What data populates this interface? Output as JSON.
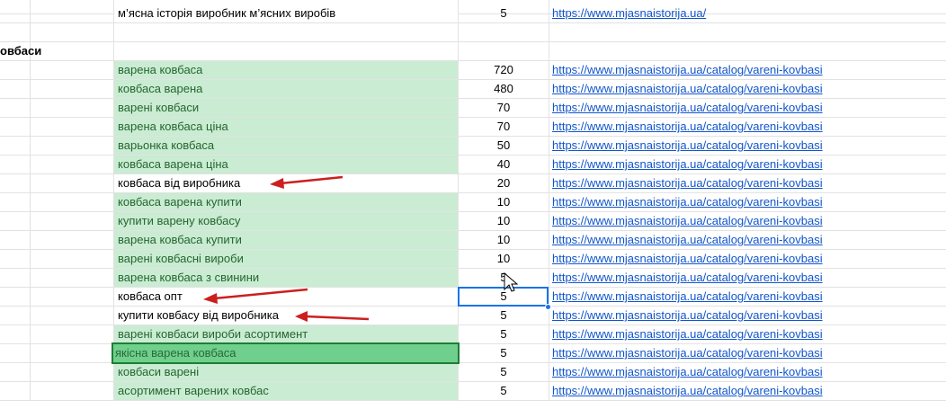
{
  "sheet": {
    "top_row": {
      "keyword": "м’ясна історія виробник м’ясних виробів",
      "volume": "5",
      "url": "https://www.mjasnaistorija.ua/"
    },
    "section_label": "овбаси",
    "rows": [
      {
        "keyword": "варена ковбаса",
        "volume": "720",
        "url": "https://www.mjasnaistorija.ua/catalog/vareni-kovbasi",
        "style": "green"
      },
      {
        "keyword": "ковбаса варена",
        "volume": "480",
        "url": "https://www.mjasnaistorija.ua/catalog/vareni-kovbasi",
        "style": "green"
      },
      {
        "keyword": "варені ковбаси",
        "volume": "70",
        "url": "https://www.mjasnaistorija.ua/catalog/vareni-kovbasi",
        "style": "green"
      },
      {
        "keyword": "варена ковбаса ціна",
        "volume": "70",
        "url": "https://www.mjasnaistorija.ua/catalog/vareni-kovbasi",
        "style": "green"
      },
      {
        "keyword": "варьонка ковбаса",
        "volume": "50",
        "url": "https://www.mjasnaistorija.ua/catalog/vareni-kovbasi",
        "style": "green"
      },
      {
        "keyword": "ковбаса варена ціна",
        "volume": "40",
        "url": "https://www.mjasnaistorija.ua/catalog/vareni-kovbasi",
        "style": "green"
      },
      {
        "keyword": "ковбаса від виробника",
        "volume": "20",
        "url": "https://www.mjasnaistorija.ua/catalog/vareni-kovbasi",
        "style": "white"
      },
      {
        "keyword": "ковбаса варена купити",
        "volume": "10",
        "url": "https://www.mjasnaistorija.ua/catalog/vareni-kovbasi",
        "style": "green"
      },
      {
        "keyword": "купити варену ковбасу",
        "volume": "10",
        "url": "https://www.mjasnaistorija.ua/catalog/vareni-kovbasi",
        "style": "green"
      },
      {
        "keyword": "варена ковбаса купити",
        "volume": "10",
        "url": "https://www.mjasnaistorija.ua/catalog/vareni-kovbasi",
        "style": "green"
      },
      {
        "keyword": "варені ковбасні вироби",
        "volume": "10",
        "url": "https://www.mjasnaistorija.ua/catalog/vareni-kovbasi",
        "style": "green"
      },
      {
        "keyword": "варена ковбаса з свинини",
        "volume": "5",
        "url": "https://www.mjasnaistorija.ua/catalog/vareni-kovbasi",
        "style": "green"
      },
      {
        "keyword": "ковбаса опт",
        "volume": "5",
        "url": "https://www.mjasnaistorija.ua/catalog/vareni-kovbasi",
        "style": "white"
      },
      {
        "keyword": "купити ковбасу від виробника",
        "volume": "5",
        "url": "https://www.mjasnaistorija.ua/catalog/vareni-kovbasi",
        "style": "white"
      },
      {
        "keyword": "варені ковбаси вироби асортимент",
        "volume": "5",
        "url": "https://www.mjasnaistorija.ua/catalog/vareni-kovbasi",
        "style": "green"
      },
      {
        "keyword": "якісна варена ковбаса",
        "volume": "5",
        "url": "https://www.mjasnaistorija.ua/catalog/vareni-kovbasi",
        "style": "selected"
      },
      {
        "keyword": "ковбаси варені",
        "volume": "5",
        "url": "https://www.mjasnaistorija.ua/catalog/vareni-kovbasi",
        "style": "green"
      },
      {
        "keyword": "асортимент варених ковбас",
        "volume": "5",
        "url": "https://www.mjasnaistorija.ua/catalog/vareni-kovbasi",
        "style": "green"
      }
    ]
  },
  "annotations": {
    "arrow_color": "#cc1f1f"
  },
  "icons": {
    "cursor": "mouse-pointer-icon"
  }
}
